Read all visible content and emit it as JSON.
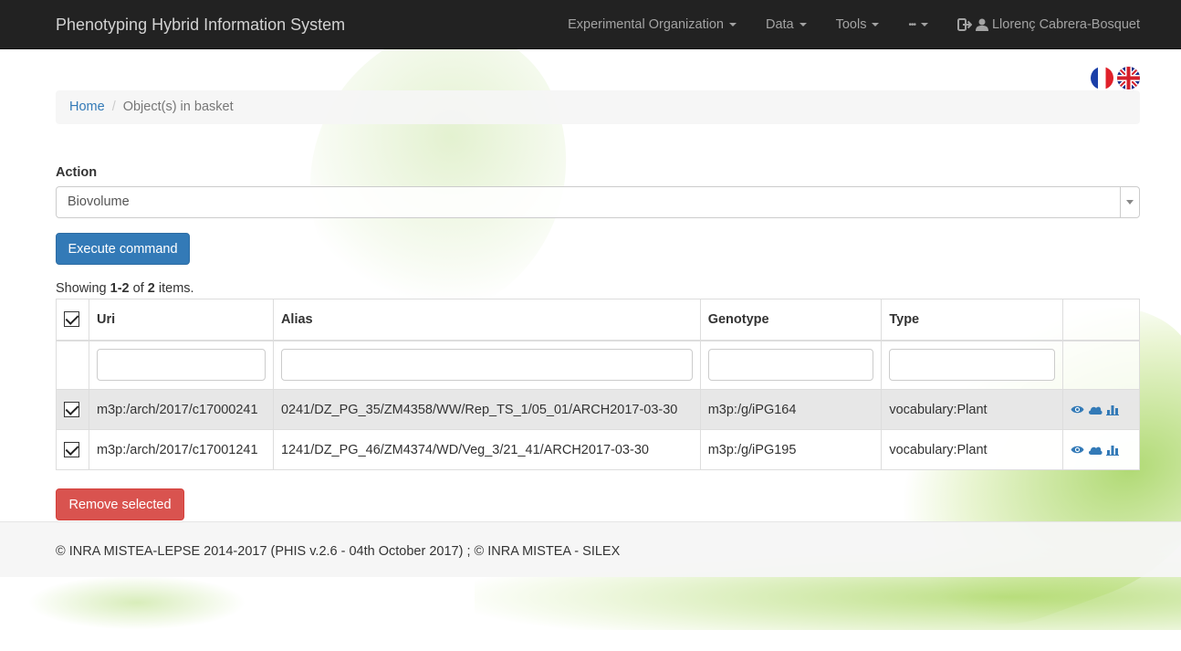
{
  "navbar": {
    "brand": "Phenotyping Hybrid Information System",
    "items": [
      {
        "label": "Experimental Organization"
      },
      {
        "label": "Data"
      },
      {
        "label": "Tools"
      },
      {
        "label": "•••"
      }
    ],
    "user": "Llorenç Cabrera-Bosquet"
  },
  "breadcrumb": {
    "home": "Home",
    "current": "Object(s) in basket"
  },
  "action": {
    "label": "Action",
    "selected": "Biovolume",
    "execute_label": "Execute command"
  },
  "summary": {
    "prefix": "Showing ",
    "range": "1-2",
    "of": " of ",
    "total": "2",
    "suffix": " items."
  },
  "table": {
    "headers": {
      "uri": "Uri",
      "alias": "Alias",
      "genotype": "Genotype",
      "type": "Type"
    },
    "rows": [
      {
        "uri": "m3p:/arch/2017/c17000241",
        "alias": "0241/DZ_PG_35/ZM4358/WW/Rep_TS_1/05_01/ARCH2017-03-30",
        "genotype": "m3p:/g/iPG164",
        "type": "vocabulary:Plant"
      },
      {
        "uri": "m3p:/arch/2017/c17001241",
        "alias": "1241/DZ_PG_46/ZM4374/WD/Veg_3/21_41/ARCH2017-03-30",
        "genotype": "m3p:/g/iPG195",
        "type": "vocabulary:Plant"
      }
    ]
  },
  "remove_label": "Remove selected",
  "footer": "© INRA MISTEA-LEPSE 2014-2017 (PHIS v.2.6 - 04th October 2017) ; © INRA MISTEA - SILEX",
  "colors": {
    "navbar": "#222222",
    "primary": "#337ab7",
    "danger": "#d9534f"
  }
}
